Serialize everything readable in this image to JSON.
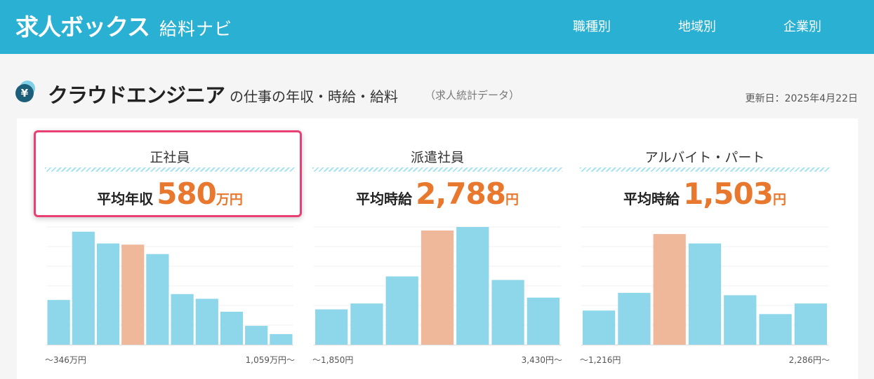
{
  "header": {
    "logo_main": "求人ボックス",
    "logo_sub": "給料ナビ",
    "nav": [
      {
        "label": "職種別"
      },
      {
        "label": "地域別"
      },
      {
        "label": "企業別"
      }
    ]
  },
  "page": {
    "title_main": "クラウドエンジニア",
    "title_rest": "の仕事の年収・時給・給料",
    "title_note": "（求人統計データ）",
    "updated": "更新日：2025年4月22日",
    "icon": "yen-coin-icon",
    "yen_symbol": "¥"
  },
  "colors": {
    "header_bg": "#2ab0d3",
    "accent_orange": "#e8782e",
    "bar": "#8ed7ea",
    "bar_highlight": "#efb89a",
    "selection_border": "#ea3f72"
  },
  "panels": [
    {
      "title": "正社員",
      "avg_label": "平均年収",
      "avg_value": "580",
      "avg_unit": "万円",
      "range_min": "〜346万円",
      "range_max": "1,059万円〜",
      "selected": true
    },
    {
      "title": "派遣社員",
      "avg_label": "平均時給",
      "avg_value": "2,788",
      "avg_unit": "円",
      "range_min": "〜1,850円",
      "range_max": "3,430円〜",
      "selected": false
    },
    {
      "title": "アルバイト・パート",
      "avg_label": "平均時給",
      "avg_value": "1,503",
      "avg_unit": "円",
      "range_min": "〜1,216円",
      "range_max": "2,286円〜",
      "selected": false
    }
  ],
  "chart_data": [
    {
      "type": "bar",
      "series": [
        {
          "values": [
            0.38,
            0.96,
            0.86,
            0.85,
            0.77,
            0.43,
            0.39,
            0.28,
            0.16,
            0.09
          ]
        }
      ],
      "highlight_index": 3,
      "x_range": [
        "〜346万円",
        "1,059万円〜"
      ],
      "grid": true
    },
    {
      "type": "bar",
      "series": [
        {
          "values": [
            0.3,
            0.35,
            0.58,
            0.97,
            1.0,
            0.55,
            0.4
          ]
        }
      ],
      "highlight_index": 3,
      "x_range": [
        "〜1,850円",
        "3,430円〜"
      ],
      "grid": true
    },
    {
      "type": "bar",
      "series": [
        {
          "values": [
            0.29,
            0.44,
            0.94,
            0.86,
            0.42,
            0.26,
            0.35
          ]
        }
      ],
      "highlight_index": 2,
      "x_range": [
        "〜1,216円",
        "2,286円〜"
      ],
      "grid": true
    }
  ]
}
